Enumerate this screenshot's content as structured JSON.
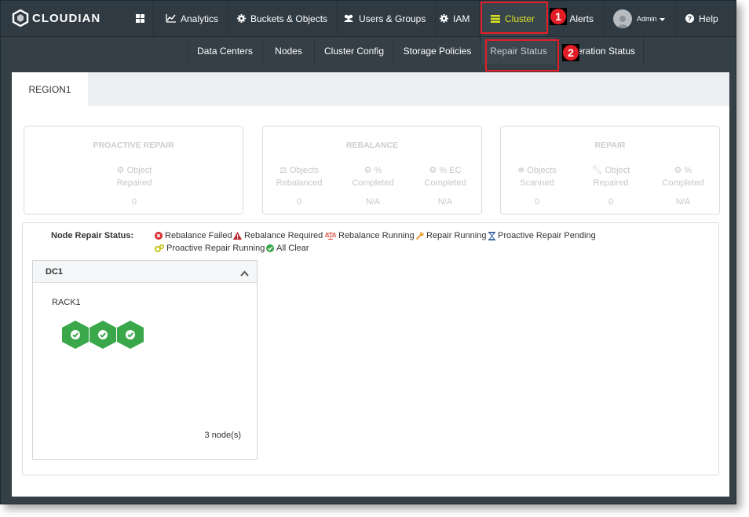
{
  "app": {
    "brand": "CLOUDIAN"
  },
  "topnav": {
    "items": [
      {
        "label": "",
        "icon": "dashboard-icon"
      },
      {
        "label": "Analytics",
        "icon": "chart-icon"
      },
      {
        "label": "Buckets & Objects",
        "icon": "gear-icon"
      },
      {
        "label": "Users & Groups",
        "icon": "users-icon"
      },
      {
        "label": "IAM",
        "icon": "gear-icon"
      },
      {
        "label": "Cluster",
        "icon": "server-icon",
        "active": true
      },
      {
        "label": "Alerts",
        "icon": "bell-icon"
      },
      {
        "label": "Admin",
        "icon": "avatar-icon"
      },
      {
        "label": "Help",
        "icon": "question-icon"
      }
    ]
  },
  "subnav": {
    "items": [
      "Data Centers",
      "Nodes",
      "Cluster Config",
      "Storage Policies",
      "Repair Status",
      "Operation Status"
    ],
    "active": "Repair Status"
  },
  "annotations": {
    "badge1": "1",
    "badge2": "2"
  },
  "region_tab": "REGION1",
  "cards": {
    "proactive": {
      "title": "PROACTIVE REPAIR",
      "metrics": [
        {
          "line1": "Object",
          "line2": "Repaired",
          "value": "0"
        }
      ]
    },
    "rebalance": {
      "title": "REBALANCE",
      "metrics": [
        {
          "line1": "Objects",
          "line2": "Rebalanced",
          "value": "0"
        },
        {
          "line1": "%",
          "line2": "Completed",
          "value": "N/A"
        },
        {
          "line1": "% EC",
          "line2": "Completed",
          "value": "N/A"
        }
      ]
    },
    "repair": {
      "title": "REPAIR",
      "metrics": [
        {
          "line1": "Objects",
          "line2": "Scanned",
          "value": "0"
        },
        {
          "line1": "Object",
          "line2": "Repaired",
          "value": "0"
        },
        {
          "line1": "%",
          "line2": "Completed",
          "value": "N/A"
        }
      ]
    }
  },
  "legend": {
    "title": "Node Repair Status:",
    "items": [
      {
        "label": "Rebalance Failed",
        "icon": "x-circle-icon",
        "color": "#d9262b"
      },
      {
        "label": "Rebalance Required",
        "icon": "warning-icon",
        "color": "#b9282c"
      },
      {
        "label": "Rebalance Running",
        "icon": "scale-icon",
        "color": "#e05a4e"
      },
      {
        "label": "Repair Running",
        "icon": "wrench-icon",
        "color": "#e8a032"
      },
      {
        "label": "Proactive Repair Pending",
        "icon": "hourglass-icon",
        "color": "#2c5aa0"
      },
      {
        "label": "Proactive Repair Running",
        "icon": "gears-icon",
        "color": "#c4c31c"
      },
      {
        "label": "All Clear",
        "icon": "check-circle-icon",
        "color": "#3aa84a"
      }
    ]
  },
  "datacenter": {
    "name": "DC1",
    "rack": "RACK1",
    "nodes": [
      {
        "status": "All Clear"
      },
      {
        "status": "All Clear"
      },
      {
        "status": "All Clear"
      }
    ],
    "node_count_label": "3 node(s)"
  },
  "colors": {
    "accent": "#d9e021",
    "highlight": "#e41e26",
    "ok": "#3aa84a"
  }
}
